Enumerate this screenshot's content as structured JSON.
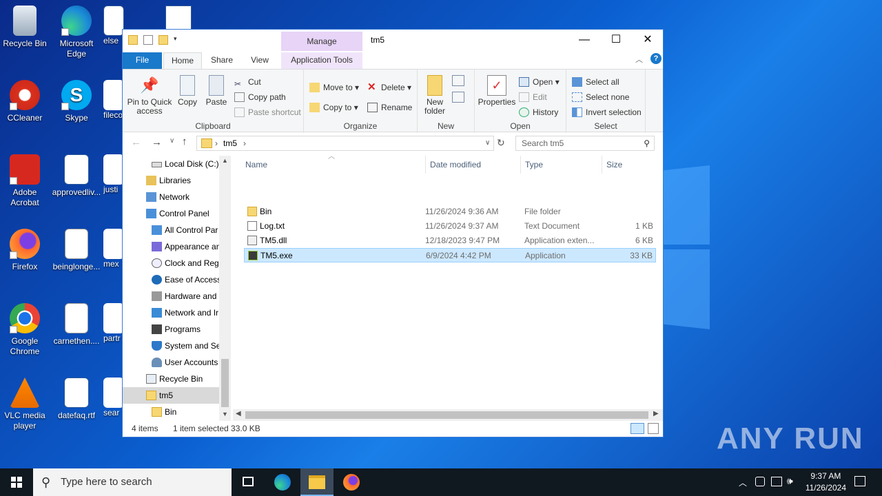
{
  "desktop": {
    "icons": [
      {
        "label": "Recycle Bin"
      },
      {
        "label": "Microsoft Edge"
      },
      {
        "label": "else"
      },
      {
        "label": "CCleaner"
      },
      {
        "label": "Skype"
      },
      {
        "label": "fileco"
      },
      {
        "label": "Adobe Acrobat"
      },
      {
        "label": "approvedliv..."
      },
      {
        "label": "justi"
      },
      {
        "label": "Firefox"
      },
      {
        "label": "beinglonge..."
      },
      {
        "label": "mex"
      },
      {
        "label": "Google Chrome"
      },
      {
        "label": "carnethen...."
      },
      {
        "label": "partr"
      },
      {
        "label": "VLC media player"
      },
      {
        "label": "datefaq.rtf"
      },
      {
        "label": "sear"
      }
    ],
    "watermark": "ANY RUN"
  },
  "window": {
    "title": "tm5",
    "manage_label": "Manage",
    "tabs": {
      "file": "File",
      "home": "Home",
      "share": "Share",
      "view": "View",
      "app_tools": "Application Tools"
    },
    "controls": {
      "minimize": "—",
      "maximize": "☐",
      "close": "✕"
    }
  },
  "ribbon": {
    "clipboard": {
      "label": "Clipboard",
      "pin": "Pin to Quick access",
      "copy": "Copy",
      "paste": "Paste",
      "cut": "Cut",
      "copy_path": "Copy path",
      "paste_shortcut": "Paste shortcut"
    },
    "organize": {
      "label": "Organize",
      "move_to": "Move to",
      "copy_to": "Copy to",
      "delete": "Delete",
      "rename": "Rename"
    },
    "new": {
      "label": "New",
      "new_folder": "New folder"
    },
    "open": {
      "label": "Open",
      "properties": "Properties",
      "open": "Open",
      "edit": "Edit",
      "history": "History"
    },
    "select": {
      "label": "Select",
      "select_all": "Select all",
      "select_none": "Select none",
      "invert": "Invert selection"
    }
  },
  "address": {
    "path": "tm5",
    "search_placeholder": "Search tm5"
  },
  "nav": {
    "items": [
      {
        "label": "Local Disk (C:)"
      },
      {
        "label": "Libraries"
      },
      {
        "label": "Network"
      },
      {
        "label": "Control Panel"
      },
      {
        "label": "All Control Par"
      },
      {
        "label": "Appearance an"
      },
      {
        "label": "Clock and Regi"
      },
      {
        "label": "Ease of Access"
      },
      {
        "label": "Hardware and"
      },
      {
        "label": "Network and Ir"
      },
      {
        "label": "Programs"
      },
      {
        "label": "System and Se"
      },
      {
        "label": "User Accounts"
      },
      {
        "label": "Recycle Bin"
      },
      {
        "label": "tm5"
      },
      {
        "label": "Bin"
      }
    ]
  },
  "files": {
    "columns": {
      "name": "Name",
      "date": "Date modified",
      "type": "Type",
      "size": "Size"
    },
    "rows": [
      {
        "name": "Bin",
        "date": "11/26/2024 9:36 AM",
        "type": "File folder",
        "size": ""
      },
      {
        "name": "Log.txt",
        "date": "11/26/2024 9:37 AM",
        "type": "Text Document",
        "size": "1 KB"
      },
      {
        "name": "TM5.dll",
        "date": "12/18/2023 9:47 PM",
        "type": "Application exten...",
        "size": "6 KB"
      },
      {
        "name": "TM5.exe",
        "date": "6/9/2024 4:42 PM",
        "type": "Application",
        "size": "33 KB"
      }
    ]
  },
  "status": {
    "count": "4 items",
    "selected": "1 item selected  33.0 KB"
  },
  "taskbar": {
    "search_placeholder": "Type here to search",
    "time": "9:37 AM",
    "date": "11/26/2024"
  }
}
